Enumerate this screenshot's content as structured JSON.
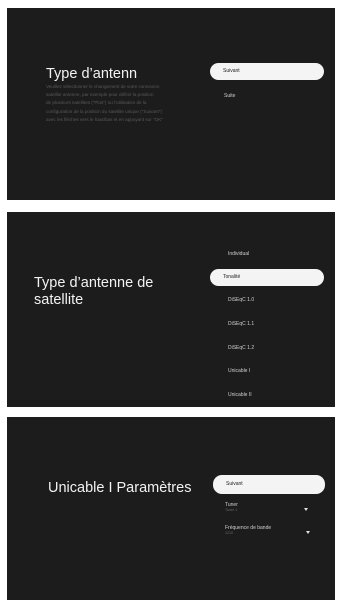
{
  "screens": [
    {
      "title": "Type d’antenn",
      "description": "Veuillez sélectionner le changement de votre connexion\nsatellite antenne, par exemple pour définir la position\nde plusieurs satellites (\"Plus\") ou l'utilisation de la\nconfiguration de la position du satellite unique (\"Suivant\")\navec les flèches vers le haut/bas et en appuyant sur \"OK\"",
      "selected": "Suivant",
      "options": [
        "Suite"
      ]
    },
    {
      "title": "Type d’antenne de satellite",
      "options_before": [
        "Individual"
      ],
      "selected": "Tonalité",
      "options_after": [
        "DiSEqC 1.0",
        "DiSEqC 1.1",
        "DiSEqC 1.2",
        "Unicable I",
        "Unicable II"
      ]
    },
    {
      "title": "Unicable I Paramètres",
      "selected": "Suivant",
      "dropdowns": [
        {
          "label": "Tuner",
          "value": "Tuner 1"
        },
        {
          "label": "Fréquence de bande",
          "value": "1210"
        }
      ]
    }
  ],
  "colors": {
    "background": "#1c1c1c",
    "highlight": "#f4f4f4",
    "text": "#f2f2f2"
  },
  "icons": {
    "dropdown": "chevron-down-icon"
  }
}
